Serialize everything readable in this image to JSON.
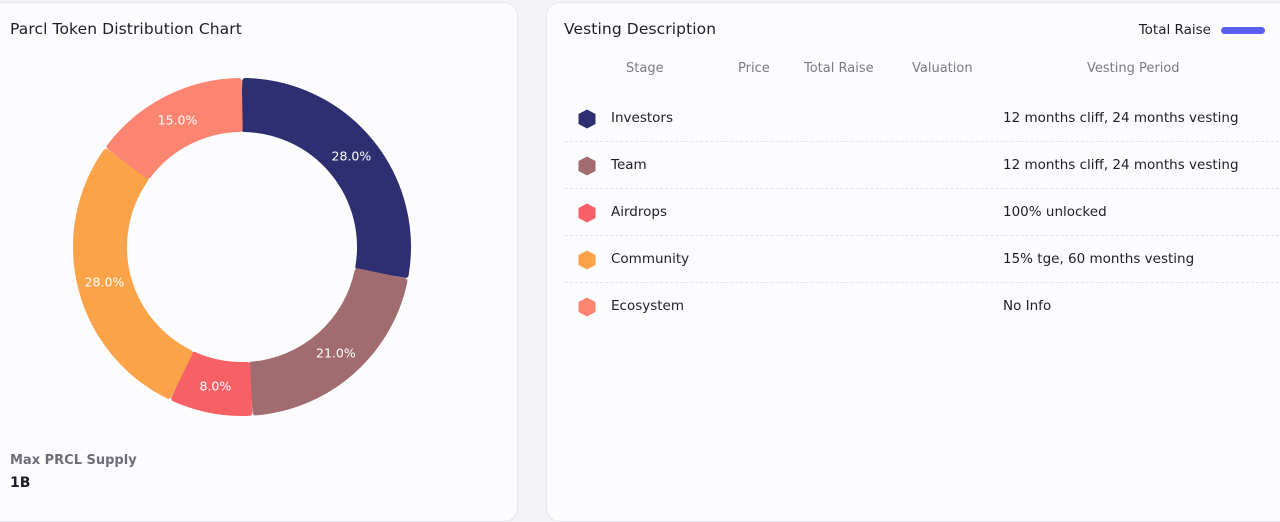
{
  "distribution_card": {
    "title": "Parcl Token Distribution Chart",
    "max_supply_label": "Max PRCL Supply",
    "max_supply_value": "1B"
  },
  "chart_data": {
    "type": "pie",
    "title": "Parcl Token Distribution Chart",
    "categories": [
      "Investors",
      "Team",
      "Airdrops",
      "Community",
      "Ecosystem"
    ],
    "values": [
      28.0,
      21.0,
      8.0,
      28.0,
      15.0
    ],
    "labels": [
      "28.0%",
      "21.0%",
      "8.0%",
      "28.0%",
      "15.0%"
    ],
    "colors": [
      "#2d2f71",
      "#a06c70",
      "#f76165",
      "#fba348",
      "#fb8571"
    ]
  },
  "vesting_card": {
    "title": "Vesting Description",
    "legend_label": "Total Raise",
    "legend_color": "#5a5ff0",
    "columns": [
      "Stage",
      "Price",
      "Total Raise",
      "Valuation",
      "Vesting Period"
    ],
    "rows": [
      {
        "stage": "Investors",
        "vesting": "12 months cliff, 24 months vesting",
        "color": "#2d2f71"
      },
      {
        "stage": "Team",
        "vesting": "12 months cliff, 24 months vesting",
        "color": "#a06c70"
      },
      {
        "stage": "Airdrops",
        "vesting": "100% unlocked",
        "color": "#f76165"
      },
      {
        "stage": "Community",
        "vesting": "15% tge, 60 months vesting",
        "color": "#fba348"
      },
      {
        "stage": "Ecosystem",
        "vesting": "No Info",
        "color": "#fb8571"
      }
    ]
  }
}
